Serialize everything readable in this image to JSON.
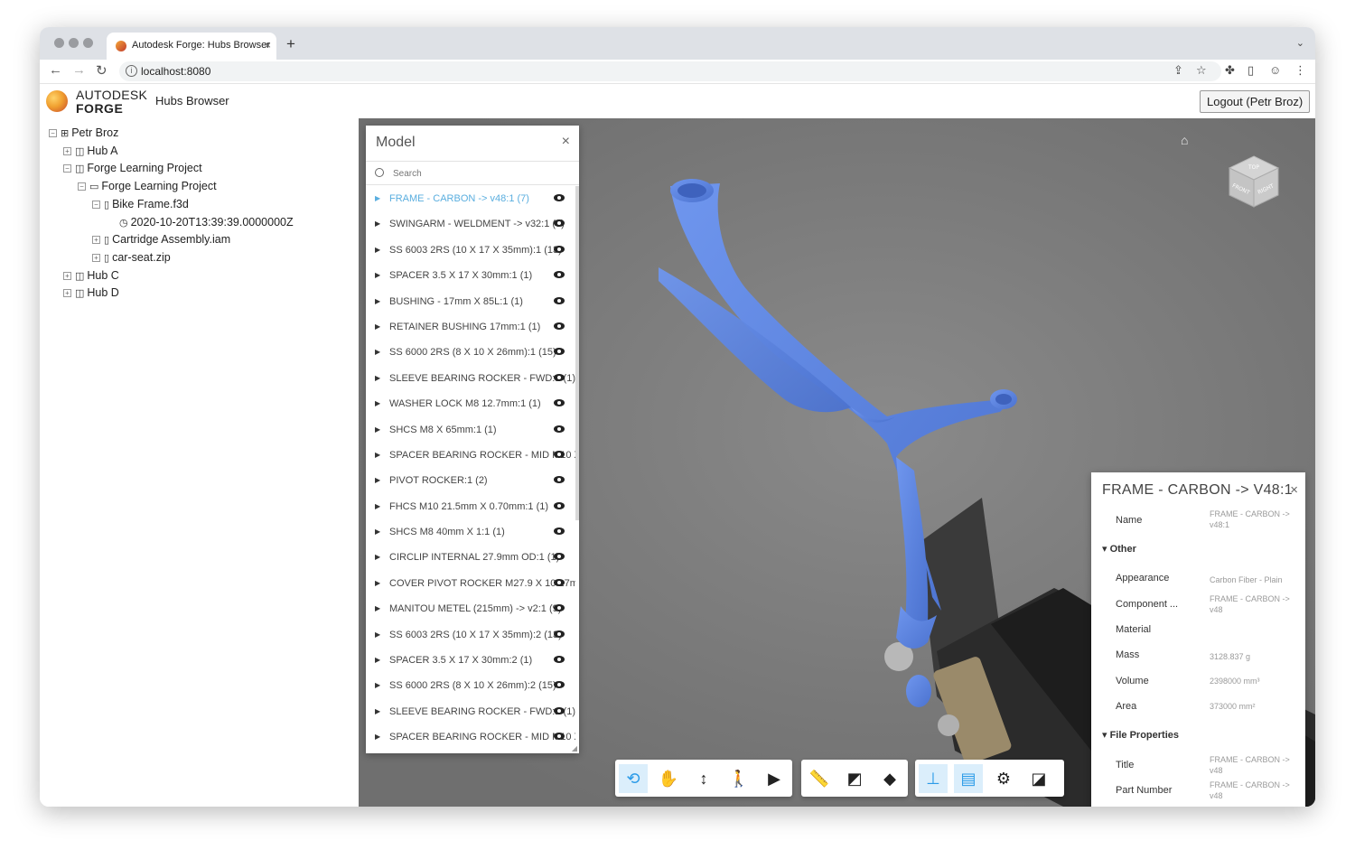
{
  "browser": {
    "tab_title": "Autodesk Forge: Hubs Browser",
    "new_tab": "+",
    "url": "localhost:8080"
  },
  "header": {
    "logo_top": "AUTODESK",
    "logo_bottom": "FORGE",
    "app_title": "Hubs Browser",
    "logout_label": "Logout (Petr Broz)"
  },
  "tree": [
    {
      "label": "Petr Broz",
      "toggle": "−",
      "icon": "user-group-icon"
    },
    {
      "label": "Hub A",
      "toggle": "+",
      "icon": "hub-icon"
    },
    {
      "label": "Forge Learning Project",
      "toggle": "−",
      "icon": "hub-icon"
    },
    {
      "label": "Forge Learning Project",
      "toggle": "−",
      "icon": "folder-icon"
    },
    {
      "label": "Bike Frame.f3d",
      "toggle": "−",
      "icon": "file-icon"
    },
    {
      "label": "2020-10-20T13:39:39.0000000Z",
      "toggle": "",
      "icon": "clock-icon"
    },
    {
      "label": "Cartridge Assembly.iam",
      "toggle": "+",
      "icon": "file-icon"
    },
    {
      "label": "car-seat.zip",
      "toggle": "+",
      "icon": "file-icon"
    },
    {
      "label": "Hub C",
      "toggle": "+",
      "icon": "hub-icon"
    },
    {
      "label": "Hub D",
      "toggle": "+",
      "icon": "hub-icon"
    }
  ],
  "model_panel": {
    "title": "Model",
    "close": "×",
    "search_placeholder": "Search",
    "items": [
      "FRAME - CARBON -> v48:1 (7)",
      "SWINGARM - WELDMENT -> v32:1 (9)",
      "SS 6003 2RS (10 X 17 X 35mm):1 (13)",
      "SPACER 3.5 X 17 X 30mm:1 (1)",
      "BUSHING - 17mm X 85L:1 (1)",
      "RETAINER BUSHING 17mm:1 (1)",
      "SS 6000 2RS (8 X 10 X 26mm):1 (15)",
      "SLEEVE BEARING ROCKER - FWD:1 (1)",
      "WASHER LOCK M8 12.7mm:1 (1)",
      "SHCS M8 X 65mm:1 (1)",
      "SPACER BEARING ROCKER - MID M10 X",
      "PIVOT ROCKER:1 (2)",
      "FHCS M10 21.5mm X 0.70mm:1 (1)",
      "SHCS M8 40mm X 1:1 (1)",
      "CIRCLIP INTERNAL 27.9mm OD:1 (1)",
      "COVER PIVOT ROCKER M27.9 X 10.17mm:",
      "MANITOU METEL (215mm) -> v2:1 (9)",
      "SS 6003 2RS (10 X 17 X 35mm):2 (13)",
      "SPACER 3.5 X 17 X 30mm:2 (1)",
      "SS 6000 2RS (8 X 10 X 26mm):2 (15)",
      "SLEEVE BEARING ROCKER - FWD:2 (1)",
      "SPACER BEARING ROCKER - MID M10 X"
    ]
  },
  "viewcube": {
    "top": "TOP",
    "front": "FRONT",
    "right": "RIGHT"
  },
  "properties": {
    "title": "FRAME - CARBON -> V48:1",
    "name_label": "Name",
    "name_value": "FRAME - CARBON -> v48:1",
    "cat_other": "Other",
    "appearance_label": "Appearance",
    "appearance_value": "Carbon Fiber - Plain",
    "component_label": "Component ...",
    "component_value": "FRAME - CARBON -> v48",
    "material_label": "Material",
    "mass_label": "Mass",
    "mass_value": "3128.837 g",
    "volume_label": "Volume",
    "volume_value": "2398000 mm³",
    "area_label": "Area",
    "area_value": "373000 mm²",
    "cat_file": "File Properties",
    "title_label": "Title",
    "title_value": "FRAME - CARBON -> v48",
    "part_label": "Part Number",
    "part_value": "FRAME - CARBON -> v48"
  },
  "colors": {
    "frame_blue": "#5b84e0",
    "selection_blue": "#5aaedf",
    "viewer_bg": "#7c7c7c"
  }
}
